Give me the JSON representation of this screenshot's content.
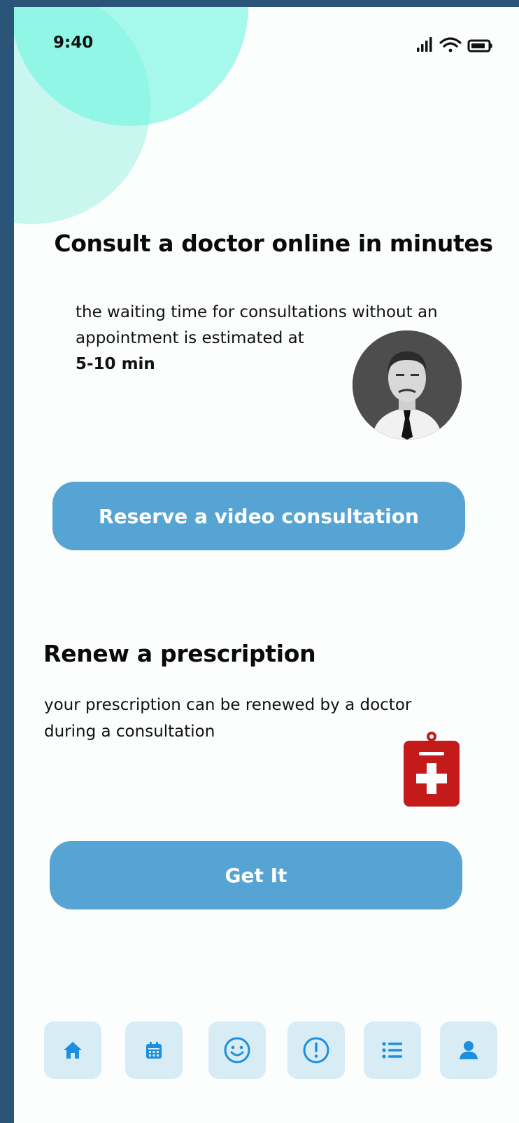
{
  "status_bar": {
    "time": "9:40",
    "icons": [
      "signal-icon",
      "wifi-icon",
      "battery-icon"
    ]
  },
  "consult": {
    "title": "Consult a doctor online in minutes",
    "description": "the waiting time for consultations without an appointment is estimated at",
    "wait_time": "5-10 min",
    "button_label": "Reserve a video consultation"
  },
  "prescription": {
    "title": "Renew a prescription",
    "description": "your prescription can be renewed by a doctor during a consultation",
    "button_label": "Get It"
  },
  "nav": {
    "items": [
      "home-icon",
      "calendar-icon",
      "smiley-icon",
      "alert-icon",
      "list-icon",
      "profile-icon"
    ]
  },
  "colors": {
    "accent": "#56a4d3",
    "nav_bg": "#d8ecf6",
    "nav_icon": "#1d8fe0",
    "medical_red": "#c41a1a",
    "blob_light": "#c9f6ee",
    "blob_teal": "#70f5e1",
    "frame": "#2a5478"
  }
}
